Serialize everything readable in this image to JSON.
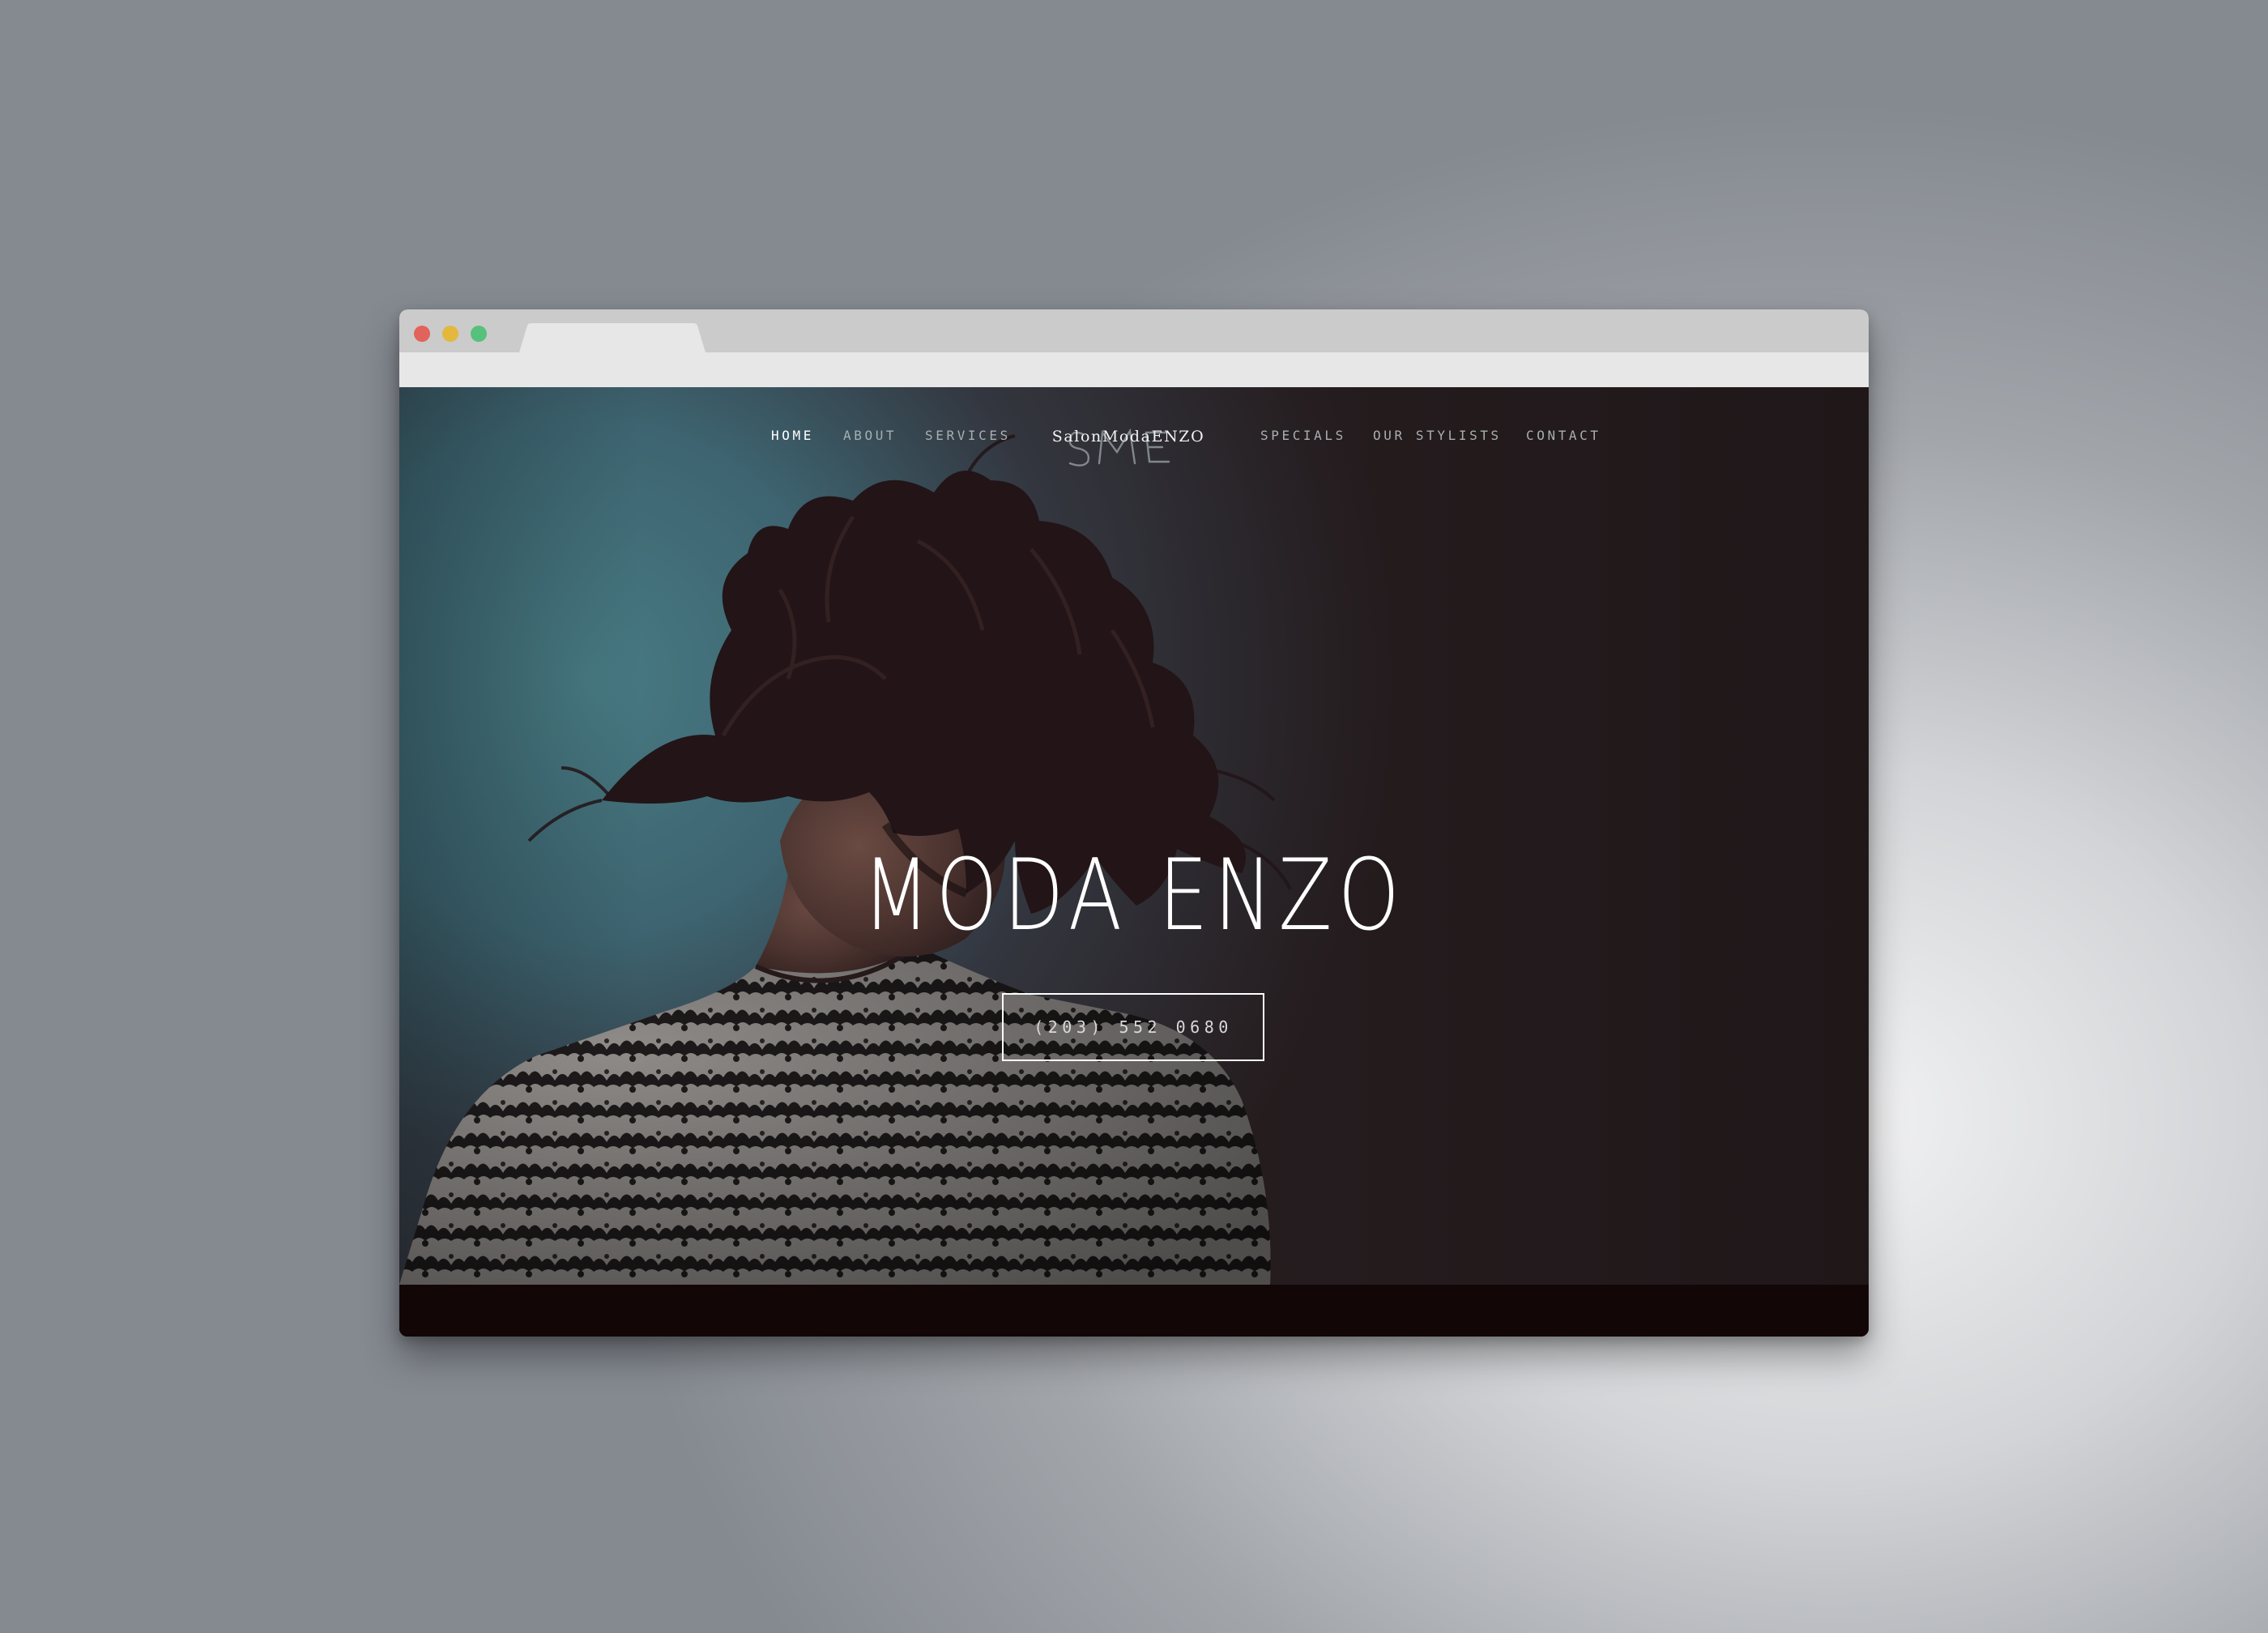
{
  "browser": {
    "window_controls": [
      {
        "name": "close",
        "color": "#e1635b"
      },
      {
        "name": "minimize",
        "color": "#e3b83d"
      },
      {
        "name": "maximize",
        "color": "#56c17b"
      }
    ],
    "tab_title": "",
    "address": ""
  },
  "site": {
    "nav_left": [
      "HOME",
      "ABOUT",
      "SERVICES"
    ],
    "nav_right": [
      "SPECIALS",
      "OUR STYLISTS",
      "CONTACT"
    ],
    "active_nav": "HOME",
    "logo": {
      "monogram": "SME",
      "text": "SalonModaENZO"
    },
    "hero": {
      "title": "MODA ENZO",
      "phone": "(203) 552 0680",
      "image": "woman-with-tossed-dark-hair-photo"
    },
    "colors": {
      "backdrop_teal": "#4b7b82",
      "backdrop_dark": "#2a2123",
      "nav_text": "#a7afb2",
      "accent_white": "#ffffff",
      "footer": "#120706"
    }
  }
}
